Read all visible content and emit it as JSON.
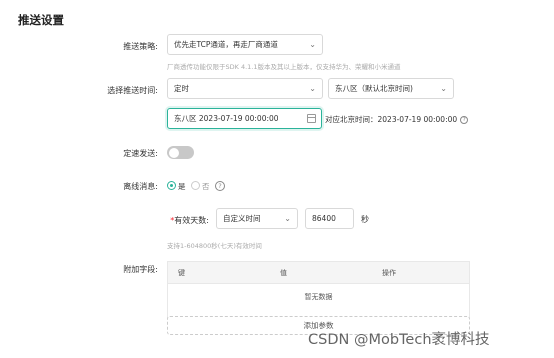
{
  "section_title": "推送设置",
  "strategy": {
    "label": "推送策略:",
    "value": "优先走TCP通道，再走厂商通道",
    "hint": "厂商透传功能仅限于SDK 4.1.1版本及其以上版本，仅支持华为、荣耀和小米通道"
  },
  "push_time": {
    "label": "选择推送时间:",
    "mode_value": "定时",
    "timezone_value": "东八区（默认北京时间)",
    "datetime_value": "东八区 2023-07-19 00:00:00",
    "beijing_text": "对应北京时间：2023-07-19 00:00:00"
  },
  "rate": {
    "label": "定速发送:",
    "enabled": false
  },
  "offline": {
    "label": "离线消息:",
    "options": [
      "是",
      "否"
    ],
    "selected": "是"
  },
  "validity": {
    "required_mark": "*",
    "label": "有效天数:",
    "mode_value": "自定义时间",
    "seconds_value": "86400",
    "unit": "秒",
    "hint": "支持1-604800秒(七天)有效时间"
  },
  "extra": {
    "label": "附加字段:",
    "columns": [
      "键",
      "值",
      "操作"
    ],
    "empty_text": "暂无数据",
    "add_label": "添加参数"
  },
  "watermark": "CSDN @MobTech袤博科技"
}
